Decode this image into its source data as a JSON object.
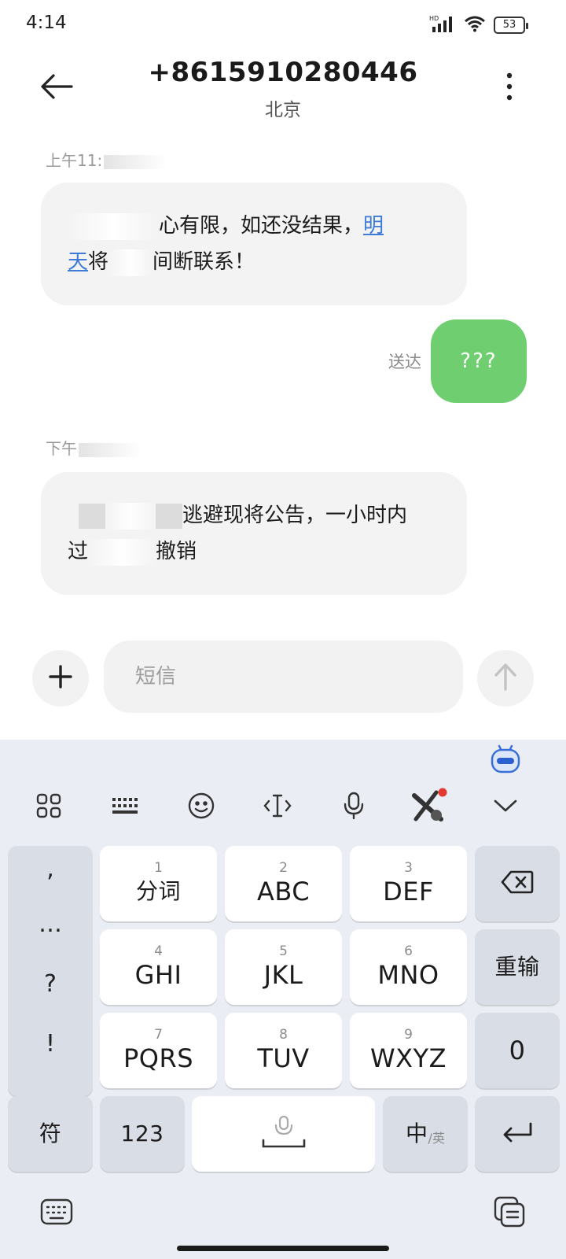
{
  "status_bar": {
    "time": "4:14",
    "battery": "53",
    "network_badge": "HD"
  },
  "header": {
    "phone_number": "+8615910280446",
    "location": "北京"
  },
  "messages": {
    "ts1": "上午11:",
    "msg1": {
      "line1_text": "心有限，如还没结果，",
      "line1_link": "明",
      "line2_link": "天",
      "line2_a": "将",
      "line2_b": "间断联系！"
    },
    "sent_status": "送达",
    "sent_text": "???",
    "ts2": "下午",
    "msg2": {
      "line1_text": "逃避现将公告，一小时内",
      "line2_a": "过",
      "line2_b": "撤销"
    }
  },
  "composer": {
    "placeholder": "短信"
  },
  "keyboard": {
    "keys": {
      "k1": {
        "num": "1",
        "label": "分词"
      },
      "k2": {
        "num": "2",
        "label": "ABC"
      },
      "k3": {
        "num": "3",
        "label": "DEF"
      },
      "k4": {
        "num": "4",
        "label": "GHI"
      },
      "k5": {
        "num": "5",
        "label": "JKL"
      },
      "k6": {
        "num": "6",
        "label": "MNO"
      },
      "k7": {
        "num": "7",
        "label": "PQRS"
      },
      "k8": {
        "num": "8",
        "label": "TUV"
      },
      "k9": {
        "num": "9",
        "label": "WXYZ"
      }
    },
    "punct": [
      ",",
      "…",
      "?",
      "!"
    ],
    "reenter": "重输",
    "zero": "0",
    "symbols": "符",
    "numbers": "123",
    "lang_main": "中",
    "lang_sub": "/英"
  },
  "colors": {
    "sent_bubble": "#6fce6f",
    "link": "#3d7bd6",
    "keyboard_bg": "#eaedf3"
  }
}
